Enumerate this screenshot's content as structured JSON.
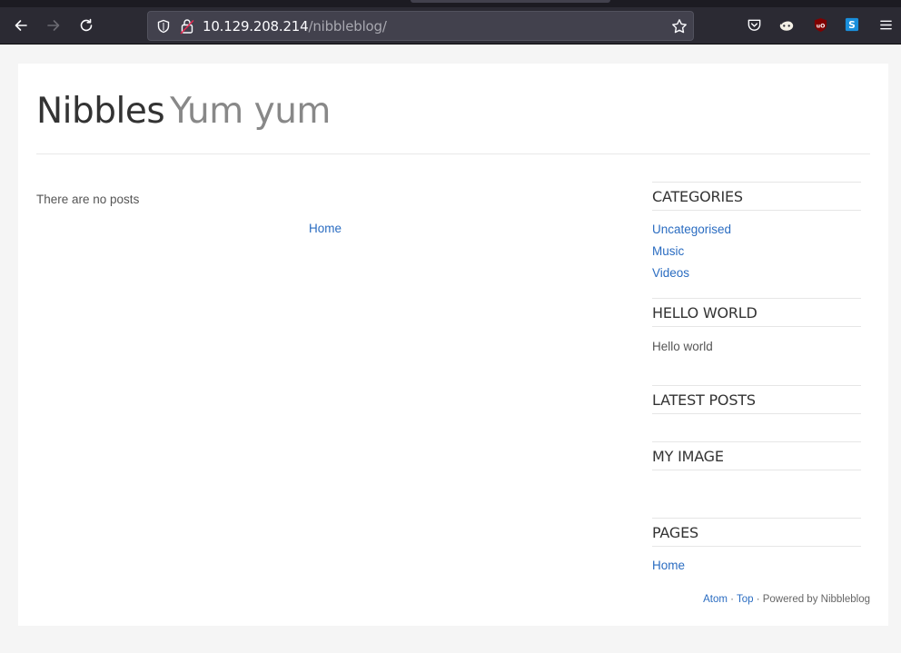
{
  "browser": {
    "url_host": "10.129.208.214",
    "url_path": "/nibbleblog/",
    "icons": [
      "back-icon",
      "forward-icon",
      "reload-icon",
      "shield-icon",
      "insecure-lock-icon",
      "bookmark-star-icon",
      "pocket-icon",
      "extension-icon",
      "ublock-icon",
      "s-extension-icon",
      "menu-icon"
    ]
  },
  "site": {
    "name": "Nibbles",
    "slogan": "Yum yum"
  },
  "main": {
    "empty_message": "There are no posts",
    "pager_home": "Home"
  },
  "sidebar": {
    "categories": {
      "title": "CATEGORIES",
      "items": [
        {
          "label": "Uncategorised"
        },
        {
          "label": "Music"
        },
        {
          "label": "Videos"
        }
      ]
    },
    "hello_world": {
      "title": "HELLO WORLD",
      "text": "Hello world"
    },
    "latest_posts": {
      "title": "LATEST POSTS"
    },
    "my_image": {
      "title": "MY IMAGE"
    },
    "pages": {
      "title": "PAGES",
      "items": [
        {
          "label": "Home"
        }
      ]
    }
  },
  "footer": {
    "atom": "Atom",
    "sep1": " · ",
    "top": "Top",
    "powered": " · Powered by Nibbleblog"
  },
  "colors": {
    "link": "#2a6cc1",
    "chrome_bg": "#2b2a33",
    "urlbar_bg": "#42414d"
  }
}
